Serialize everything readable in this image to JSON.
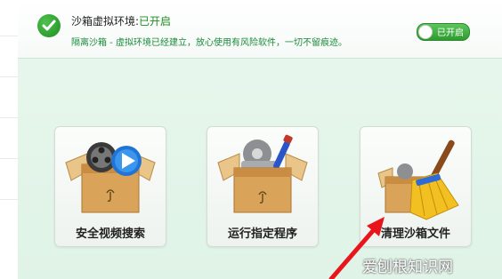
{
  "status": {
    "prefix": "沙箱虚拟环境:",
    "state": "已开启",
    "description": "隔离沙箱 - 虚拟环境已经建立，放心使用有风险软件，一切不留痕迹。"
  },
  "toggle": {
    "label": "已开启",
    "on": true
  },
  "cards": [
    {
      "label": "安全视频搜索",
      "icon": "video-box-icon"
    },
    {
      "label": "运行指定程序",
      "icon": "program-box-icon"
    },
    {
      "label": "清理沙箱文件",
      "icon": "broom-box-icon"
    }
  ],
  "watermark": "爱刨根知识网",
  "colors": {
    "accent": "#1b8e1b",
    "panel": "#e3f4e8",
    "arrow": "#e8151c"
  }
}
